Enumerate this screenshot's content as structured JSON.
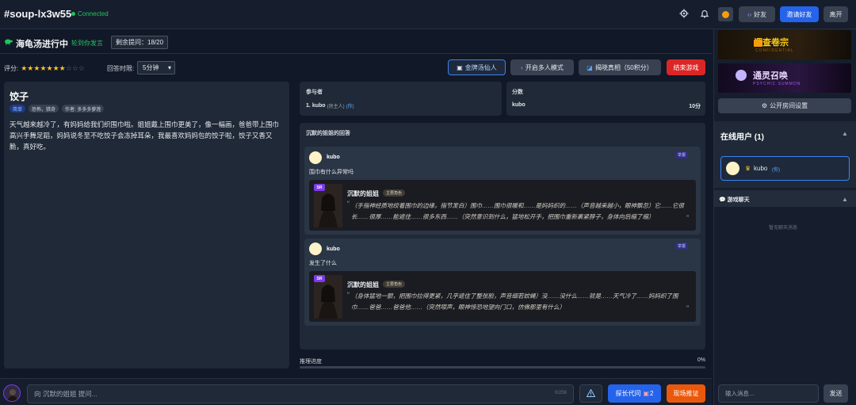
{
  "header": {
    "room_name": "#soup-lx3w55",
    "connection_status": "Connected",
    "friends_label": "好友",
    "invite_label": "邀请好友",
    "leave_label": "离开"
  },
  "game": {
    "title": "海龟汤进行中",
    "turn_status": "轮到你发言",
    "remaining_questions": "剩余提问：18/20",
    "rating_label": "评分:",
    "rating_value": 7,
    "rating_max": 10,
    "time_limit_label": "回答时限:",
    "time_limit_value": "5分钟",
    "actions": {
      "golden_soup": "金牌汤仙人",
      "multi_mode": "开启多人模式",
      "reveal_truth": "揭晓真相（50积分）",
      "end_game": "结束游戏"
    }
  },
  "story": {
    "title": "饺子",
    "tags": [
      "简单",
      "恐怖，猎奇",
      "作者: 多多多萝莲"
    ],
    "text": "天气越来越冷了，有妈妈给我们织围巾啦。姐姐戴上围巾更美了，像一幅画，爸爸带上围巾高兴手舞足蹈，妈妈说冬至不吃饺子会冻掉耳朵，我最喜欢妈妈包的饺子啦，饺子又香又脆，真好吃。"
  },
  "participants": {
    "title": "参与者",
    "entry_index": "1.",
    "name": "kubo",
    "role": "(房主人)",
    "me_tag": "(你)"
  },
  "scores": {
    "title": "分数",
    "name": "kubo",
    "score": "10分"
  },
  "answers": {
    "title": "沉默的姐姐的回答",
    "report_label": "举报",
    "items": [
      {
        "asker": "kubo",
        "question": "围巾有什么异常吗",
        "rarity": "SR",
        "responder": "沉默的姐姐",
        "badge": "主要角色",
        "reply": "（手指神经质地绞着围巾的边缘，指节发白）围巾……围巾很暖和……是妈妈织的……（声音越来越小，眼神飘忽）它……它很长……很厚……能遮住……很多东西……（突然意识到什么，猛地松开手，把围巾重新裹紧脖子，身体向后缩了缩）"
      },
      {
        "asker": "kubo",
        "question": "发生了什么",
        "rarity": "SR",
        "responder": "沉默的姐姐",
        "badge": "主要角色",
        "reply": "（身体猛地一颤，把围巾拉得更紧，几乎遮住了整张脸，声音细若蚊蝇）没……没什么……就是……天气冷了……妈妈织了围巾……爸爸……爸爸他……（突然噤声，眼神惊恐地望向门口，仿佛那里有什么）"
      }
    ]
  },
  "progress": {
    "label": "推理进度",
    "value": "0%"
  },
  "ask_bar": {
    "placeholder": "向 沉默的姐姐 提问...",
    "counter": "0/256",
    "detective_label": "探长代问",
    "detective_count": "2",
    "verify_label": "现场推证"
  },
  "right_panel": {
    "banner1_title": "调查卷宗",
    "banner1_sub": "CONFIDENTIAL",
    "banner2_title": "通灵召唤",
    "banner2_sub": "PSYCHIC SUMMON",
    "room_settings": "公开房间设置",
    "online_title": "在线用户 (1)",
    "online_user": "kubo",
    "online_me": "(你)",
    "chat_title": "游戏聊天",
    "chat_empty": "暂无聊天消息",
    "chat_placeholder": "输入消息...",
    "send_label": "发送"
  }
}
